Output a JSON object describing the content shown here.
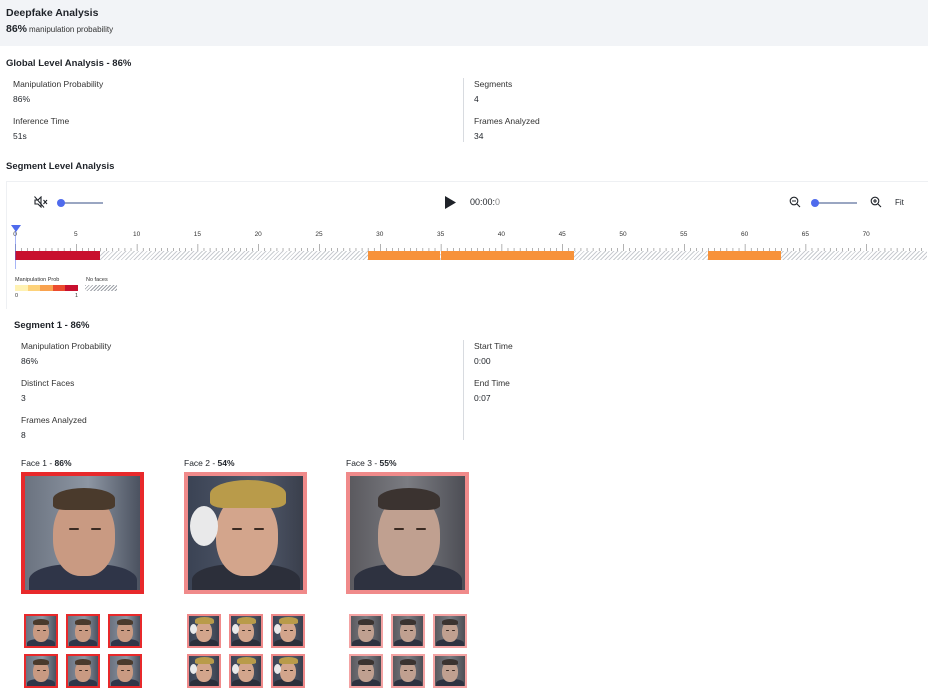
{
  "header": {
    "title": "Deepfake Analysis",
    "probability": "86%",
    "probability_label": "manipulation probability"
  },
  "global": {
    "title": "Global Level Analysis - 86%",
    "manipulation_label": "Manipulation Probability",
    "manipulation_value": "86%",
    "inference_label": "Inference Time",
    "inference_value": "51s",
    "segments_label": "Segments",
    "segments_value": "4",
    "frames_label": "Frames Analyzed",
    "frames_value": "34"
  },
  "segment_section": {
    "title": "Segment Level Analysis"
  },
  "player": {
    "time_main": "00:00:",
    "time_frac": "0",
    "fit_label": "Fit",
    "mute_icon": "speaker-muted-icon",
    "play_icon": "play-icon",
    "zoom_out_icon": "zoom-out-icon",
    "zoom_in_icon": "zoom-in-icon",
    "volume_level": 0,
    "zoom_level": 0
  },
  "timeline": {
    "tick_labels": [
      "0",
      "5",
      "10",
      "15",
      "20",
      "25",
      "30",
      "35",
      "40",
      "45",
      "50",
      "55",
      "60",
      "65",
      "70"
    ],
    "max_seconds": 75,
    "segments": [
      {
        "start": 0,
        "end": 7,
        "color": "#c8102e"
      },
      {
        "start": 29,
        "end": 35,
        "color": "#f7923a"
      },
      {
        "start": 35,
        "end": 46,
        "color": "#f7923a"
      },
      {
        "start": 57,
        "end": 63,
        "color": "#f7923a"
      }
    ]
  },
  "legend": {
    "prob_label": "Manipulation Prob",
    "no_faces_label": "No faces",
    "min": "0",
    "max": "1",
    "gradient": [
      "#fff2b3",
      "#fdd27a",
      "#f9a24e",
      "#ec4b2e",
      "#c8102e"
    ]
  },
  "segment1": {
    "title": "Segment 1 - 86%",
    "manipulation_label": "Manipulation Probability",
    "manipulation_value": "86%",
    "distinct_label": "Distinct Faces",
    "distinct_value": "3",
    "frames_label": "Frames Analyzed",
    "frames_value": "8",
    "start_label": "Start Time",
    "start_value": "0:00",
    "end_label": "End Time",
    "end_value": "0:07"
  },
  "faces": [
    {
      "label": "Face 1 - ",
      "score": "86%",
      "border": "#e8292b",
      "thumb_border": "#e8292b",
      "thumb_count": 6
    },
    {
      "label": "Face 2 - ",
      "score": "54%",
      "border": "#f08a8a",
      "thumb_border": "#f08a8a",
      "thumb_count": 6
    },
    {
      "label": "Face 3 - ",
      "score": "55%",
      "border": "#f08a8a",
      "thumb_border": "#f4a3a3",
      "thumb_count": 6
    }
  ]
}
